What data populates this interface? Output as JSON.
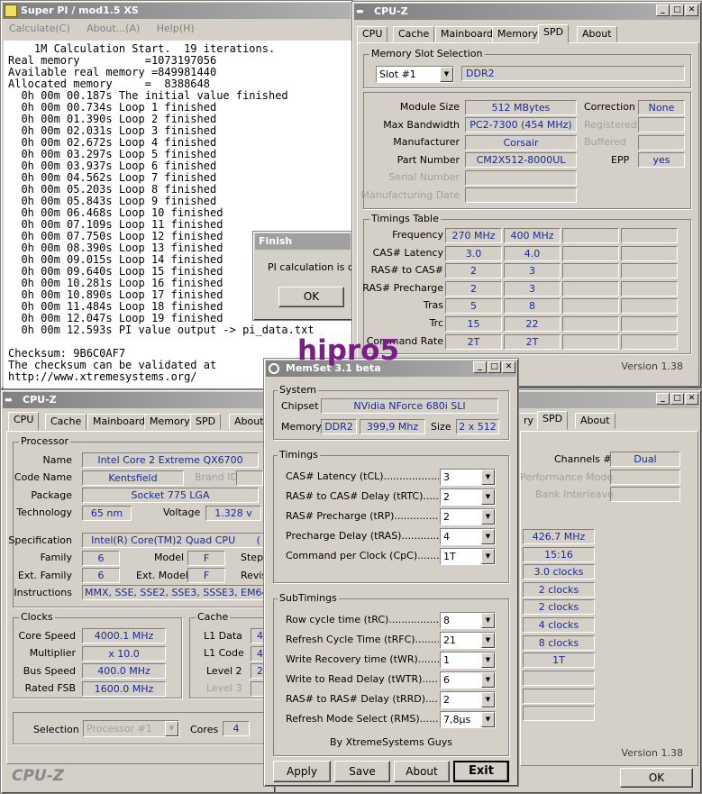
{
  "superpi": {
    "title": "Super PI / mod1.5 XS",
    "menu": [
      "Calculate(C)",
      "About...(A)",
      "Help(H)"
    ],
    "lines": [
      "    1M Calculation Start.  19 iterations.",
      "Real memory          =1073197056",
      "Available real memory =849981440",
      "Allocated memory     =  8388648",
      "  0h 00m 00.187s The initial value finished",
      "  0h 00m 00.734s Loop 1 finished",
      "  0h 00m 01.390s Loop 2 finished",
      "  0h 00m 02.031s Loop 3 finished",
      "  0h 00m 02.672s Loop 4 finished",
      "  0h 00m 03.297s Loop 5 finished",
      "  0h 00m 03.937s Loop 6 finished",
      "  0h 00m 04.562s Loop 7 finished",
      "  0h 00m 05.203s Loop 8 finished",
      "  0h 00m 05.843s Loop 9 finished",
      "  0h 00m 06.468s Loop 10 finished",
      "  0h 00m 07.109s Loop 11 finished",
      "  0h 00m 07.750s Loop 12 finished",
      "  0h 00m 08.390s Loop 13 finished",
      "  0h 00m 09.015s Loop 14 finished",
      "  0h 00m 09.640s Loop 15 finished",
      "  0h 00m 10.281s Loop 16 finished",
      "  0h 00m 10.890s Loop 17 finished",
      "  0h 00m 11.484s Loop 18 finished",
      "  0h 00m 12.047s Loop 19 finished",
      "  0h 00m 12.593s PI value output -> pi_data.txt",
      "",
      "Checksum: 9B6C0AF7",
      "The checksum can be validated at",
      "http://www.xtremesystems.org/"
    ]
  },
  "finish_dialog": {
    "title": "Finish",
    "message": "PI calculation is done!",
    "ok": "OK"
  },
  "watermark": "hipro5",
  "cpuz_spd": {
    "title": "CPU-Z",
    "tabs": [
      "CPU",
      "Cache",
      "Mainboard",
      "Memory",
      "SPD",
      "About"
    ],
    "active_tab": "SPD",
    "slot_group": "Memory Slot Selection",
    "slot": "Slot #1",
    "mem_type": "DDR2",
    "labels": {
      "module_size": "Module Size",
      "max_bw": "Max Bandwidth",
      "manufacturer": "Manufacturer",
      "part": "Part Number",
      "serial": "Serial Number",
      "mfg_date": "Manufacturing Date",
      "correction": "Correction",
      "registered": "Registered",
      "buffered": "Buffered",
      "epp": "EPP"
    },
    "module_size": "512 MBytes",
    "max_bw": "PC2-7300 (454 MHz)",
    "manufacturer": "Corsair",
    "part": "CM2X512-8000UL",
    "correction": "None",
    "epp": "yes",
    "timings_group": "Timings Table",
    "timing_rows": [
      {
        "label": "Frequency",
        "c1": "270 MHz",
        "c2": "400 MHz"
      },
      {
        "label": "CAS# Latency",
        "c1": "3.0",
        "c2": "4.0"
      },
      {
        "label": "RAS# to CAS#",
        "c1": "2",
        "c2": "3"
      },
      {
        "label": "RAS# Precharge",
        "c1": "2",
        "c2": "3"
      },
      {
        "label": "Tras",
        "c1": "5",
        "c2": "8"
      },
      {
        "label": "Trc",
        "c1": "15",
        "c2": "22"
      },
      {
        "label": "Command Rate",
        "c1": "2T",
        "c2": "2T"
      }
    ],
    "version": "Version 1.38"
  },
  "cpuz_cpu": {
    "title": "CPU-Z",
    "tabs": [
      "CPU",
      "Cache",
      "Mainboard",
      "Memory",
      "SPD",
      "About"
    ],
    "active_tab": "CPU",
    "processor_group": "Processor",
    "labels": {
      "name": "Name",
      "code_name": "Code Name",
      "brand_id": "Brand ID",
      "package": "Package",
      "technology": "Technology",
      "voltage": "Voltage",
      "specification": "Specification",
      "family": "Family",
      "model": "Model",
      "stepping": "Stepp",
      "ext_family": "Ext. Family",
      "ext_model": "Ext. Model",
      "revision": "Revis",
      "instructions": "Instructions"
    },
    "name": "Intel Core 2 Extreme QX6700",
    "code_name": "Kentsfield",
    "package": "Socket 775 LGA",
    "technology": "65 nm",
    "voltage": "1.328 v",
    "specification": "Intel(R) Core(TM)2 Quad CPU",
    "spec_tail": "(",
    "family": "6",
    "model": "F",
    "ext_family": "6",
    "ext_model": "F",
    "instructions": "MMX, SSE, SSE2, SSE3, SSSE3, EM64T",
    "clocks_group": "Clocks",
    "clock_labels": {
      "core_speed": "Core Speed",
      "multiplier": "Multiplier",
      "bus_speed": "Bus Speed",
      "rated_fsb": "Rated FSB"
    },
    "core_speed": "4000.1 MHz",
    "multiplier": "x 10.0",
    "bus_speed": "400.0 MHz",
    "rated_fsb": "1600.0 MHz",
    "cache_group": "Cache",
    "cache_labels": {
      "l1d": "L1 Data",
      "l1c": "L1 Code",
      "l2": "Level 2",
      "l3": "Level 3"
    },
    "l1d": "4",
    "l1c": "4",
    "l2": "2 x",
    "selection_label": "Selection",
    "selection": "Processor #1",
    "cores_label": "Cores",
    "cores": "4",
    "brand": "CPU-Z"
  },
  "cpuz_mem": {
    "tabs_visible": [
      "ry",
      "SPD",
      "About"
    ],
    "labels": {
      "channels": "Channels #",
      "perf_mode": "Performance Mode",
      "bank": "Bank Interleave"
    },
    "channels": "Dual",
    "values": [
      "426.7 MHz",
      "15:16",
      "3.0 clocks",
      "2 clocks",
      "2 clocks",
      "4 clocks",
      "8 clocks",
      "1T"
    ],
    "version": "Version 1.38",
    "ok": "OK"
  },
  "memset": {
    "title": "MemSet 3.1 beta",
    "system_group": "System",
    "labels": {
      "chipset": "Chipset",
      "memory": "Memory",
      "size": "Size"
    },
    "chipset": "NVidia NForce 680i SLI",
    "mem_type": "DDR2",
    "mem_freq": "399,9 Mhz",
    "size": "2 x 512",
    "timings_group": "Timings",
    "timings": [
      {
        "label": "CAS# Latency (tCL)...................",
        "value": "3"
      },
      {
        "label": "RAS# to CAS# Delay (tRTC)...........",
        "value": "2"
      },
      {
        "label": "RAS# Precharge (tRP)..................",
        "value": "2"
      },
      {
        "label": "Precharge Delay  (tRAS)...............",
        "value": "4"
      },
      {
        "label": "Command per Clock (CpC)..............",
        "value": "1T"
      }
    ],
    "subtimings_group": "SubTimings",
    "subtimings": [
      {
        "label": "Row cycle time (tRC)........................",
        "value": "8"
      },
      {
        "label": "Refresh Cycle Time (tRFC)...............",
        "value": "21"
      },
      {
        "label": "Write Recovery time (tWR)................",
        "value": "1"
      },
      {
        "label": "Write to Read Delay (tWTR)..............",
        "value": "6"
      },
      {
        "label": "RAS# to RAS# Delay (tRRD)...............",
        "value": "2"
      },
      {
        "label": "Refresh Mode Select (RMS)...............",
        "value": "7,8µs"
      }
    ],
    "credit": "By XtremeSystems Guys",
    "buttons": {
      "apply": "Apply",
      "save": "Save",
      "about": "About",
      "exit": "Exit"
    }
  }
}
